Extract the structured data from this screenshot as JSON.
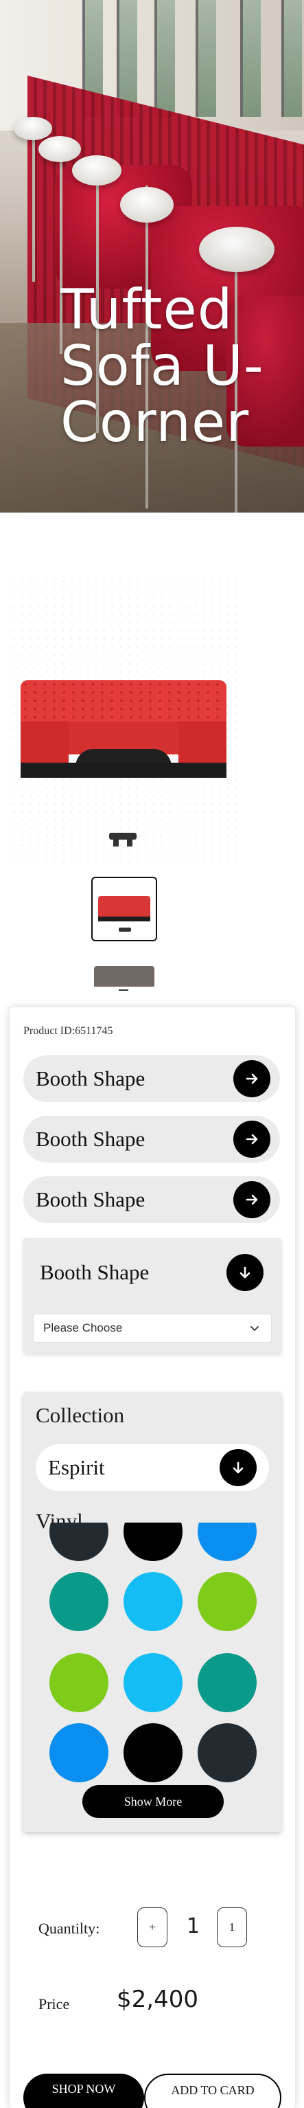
{
  "hero": {
    "title_lines": [
      "Tufted",
      "Sofa U-",
      "Corner"
    ]
  },
  "product": {
    "id_label": "Product ID:6511745"
  },
  "options": [
    {
      "label": "Booth Shape",
      "icon": "arrow-right-icon"
    },
    {
      "label": "Booth Shape",
      "icon": "arrow-right-icon"
    },
    {
      "label": "Booth Shape",
      "icon": "arrow-right-icon"
    },
    {
      "label": "Booth Shape",
      "icon": "arrow-down-icon",
      "expanded": true,
      "select_value": "Please Choose"
    }
  ],
  "collection": {
    "title": "Collection",
    "selected": "Espirit",
    "material": "Vinyl",
    "swatches": [
      "#232b31",
      "#000000",
      "#0a8ff0",
      "#0a9a8a",
      "#14bdf5",
      "#7fcb19",
      "#7fcb19",
      "#14bdf5",
      "#0a9a8a",
      "#0a8ff0",
      "#000000",
      "#232b31"
    ],
    "show_more": "Show More"
  },
  "quantity": {
    "label": "Quantilty:",
    "minus_label": "+",
    "value": "1",
    "plus_label": "1"
  },
  "price": {
    "label": "Price",
    "value": "$2,400"
  },
  "actions": {
    "shop_now": "SHOP NOW",
    "add_to_cart": "ADD TO CARD"
  }
}
